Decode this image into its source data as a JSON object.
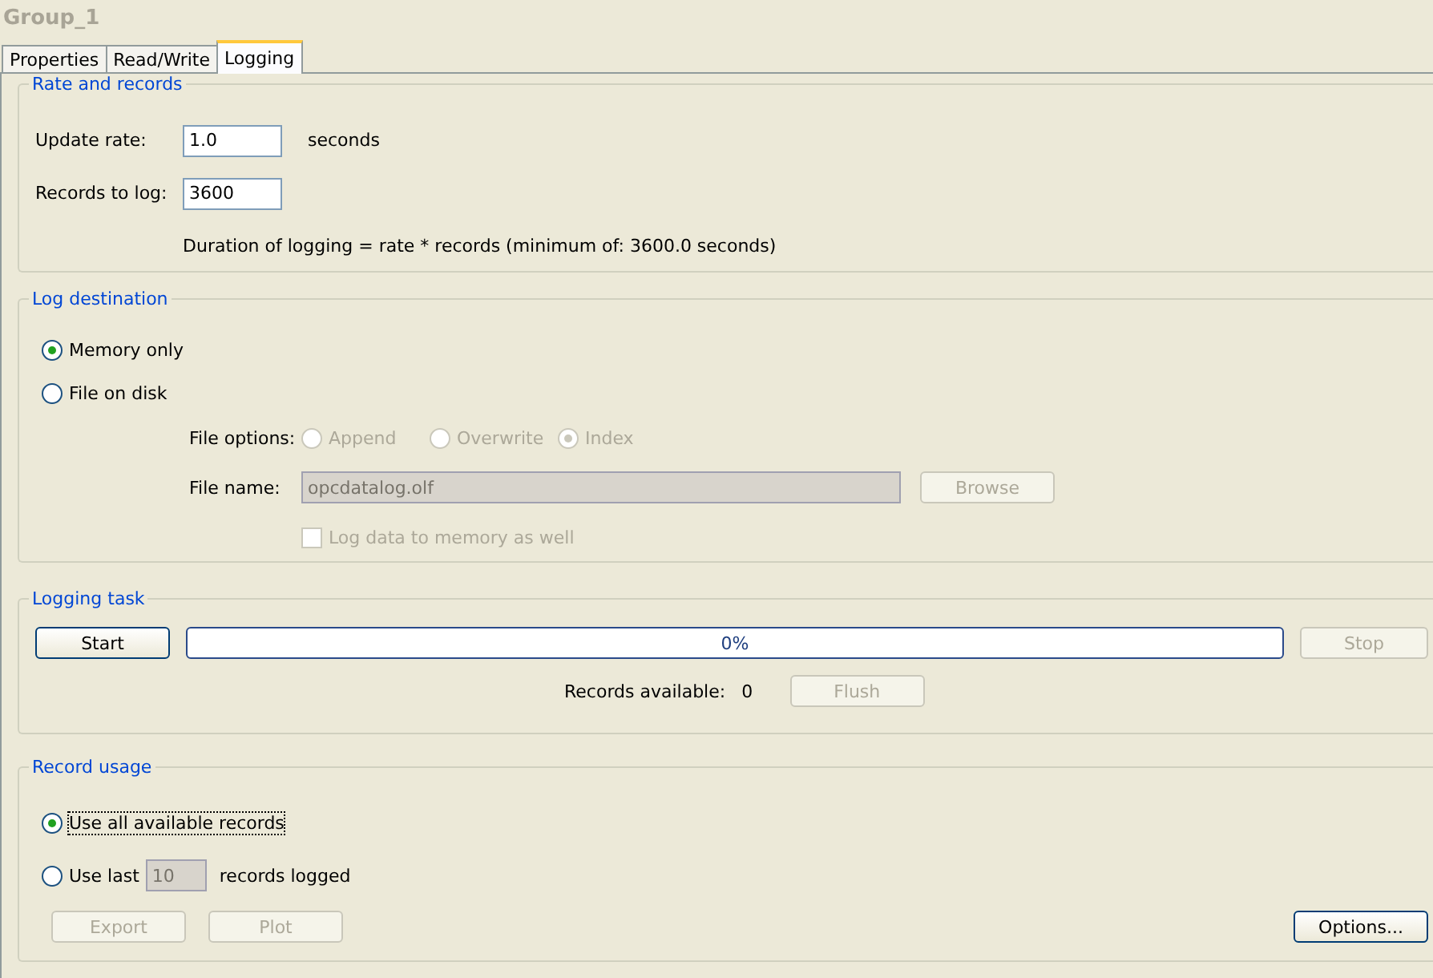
{
  "title": "Group_1",
  "tabs": [
    {
      "label": "Properties",
      "selected": false
    },
    {
      "label": "Read/Write",
      "selected": false
    },
    {
      "label": "Logging",
      "selected": true
    }
  ],
  "rate_and_records": {
    "title": "Rate and records",
    "update_rate": {
      "label": "Update rate:",
      "value": "1.0",
      "unit": "seconds"
    },
    "records_to_log": {
      "label": "Records to log:",
      "value": "3600"
    },
    "note": "Duration of logging = rate * records (minimum of: 3600.0 seconds)"
  },
  "log_destination": {
    "title": "Log destination",
    "options": [
      {
        "label": "Memory only",
        "selected": true
      },
      {
        "label": "File on disk",
        "selected": false
      }
    ],
    "file_options": {
      "label": "File options:",
      "options": [
        {
          "label": "Append",
          "selected": false,
          "disabled": true
        },
        {
          "label": "Overwrite",
          "selected": false,
          "disabled": true
        },
        {
          "label": "Index",
          "selected": true,
          "disabled": true
        }
      ]
    },
    "file_name": {
      "label": "File name:",
      "value": "opcdatalog.olf",
      "disabled": true
    },
    "browse": {
      "label": "Browse",
      "disabled": true
    },
    "log_to_memory": {
      "label": "Log data to memory as well",
      "checked": false,
      "disabled": true
    }
  },
  "logging_task": {
    "title": "Logging task",
    "start": {
      "label": "Start",
      "disabled": false
    },
    "progress": {
      "level": 0,
      "text": "0%"
    },
    "stop": {
      "label": "Stop",
      "disabled": true
    },
    "records_available": {
      "label": "Records available:",
      "value": "0"
    },
    "flush": {
      "label": "Flush",
      "disabled": true
    }
  },
  "record_usage": {
    "title": "Record usage",
    "options": [
      {
        "kind": "plain",
        "label": "Use all available records",
        "selected": true,
        "focused": true
      },
      {
        "kind": "count",
        "label": "Use last",
        "value": "10",
        "suffix": "records logged",
        "selected": false,
        "disabled": true
      }
    ],
    "buttons": [
      {
        "label": "Export",
        "disabled": true
      },
      {
        "label": "Plot",
        "disabled": true
      }
    ],
    "options_button": {
      "label": "Options...",
      "disabled": false
    }
  }
}
